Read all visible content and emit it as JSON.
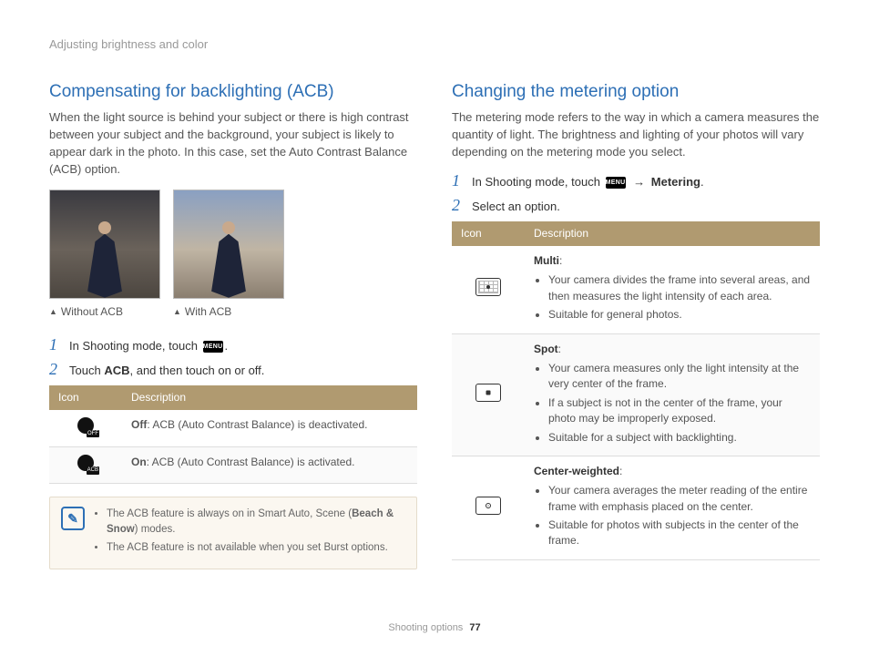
{
  "breadcrumb": "Adjusting brightness and color",
  "footer_section": "Shooting options",
  "page_number": "77",
  "left": {
    "title": "Compensating for backlighting (ACB)",
    "lead": "When the light source is behind your subject or there is high contrast between your subject and the background, your subject is likely to appear dark in the photo. In this case, set the Auto Contrast Balance (ACB) option.",
    "caption1": "Without ACB",
    "caption2": "With ACB",
    "step1_pre": "In Shooting mode, touch ",
    "step1_post": ".",
    "menu_label": "MENU",
    "step2_pre": "Touch ",
    "step2_bold": "ACB",
    "step2_post": ", and then touch on or off.",
    "th_icon": "Icon",
    "th_desc": "Description",
    "row_off_b": "Off",
    "row_off_t": ": ACB (Auto Contrast Balance) is deactivated.",
    "row_on_b": "On",
    "row_on_t": ": ACB (Auto Contrast Balance) is activated.",
    "note1_pre": "The ACB feature is always on in Smart Auto, Scene (",
    "note1_bold": "Beach & Snow",
    "note1_post": ") modes.",
    "note2": "The ACB feature is not available when you set Burst options."
  },
  "right": {
    "title": "Changing the metering option",
    "lead": "The metering mode refers to the way in which a camera measures the quantity of light. The brightness and lighting of your photos will vary depending on the metering mode you select.",
    "step1_pre": "In Shooting mode, touch ",
    "menu_label": "MENU",
    "step1_mid": " → ",
    "step1_bold": "Metering",
    "step1_post": ".",
    "step2": "Select an option.",
    "th_icon": "Icon",
    "th_desc": "Description",
    "multi_title": "Multi",
    "multi_b1": "Your camera divides the frame into several areas, and then measures the light intensity of each area.",
    "multi_b2": "Suitable for general photos.",
    "spot_title": "Spot",
    "spot_b1": "Your camera measures only the light intensity at the very center of the frame.",
    "spot_b2": "If a subject is not in the center of the frame, your photo may be improperly exposed.",
    "spot_b3": "Suitable for a subject with backlighting.",
    "center_title": "Center-weighted",
    "center_b1": "Your camera averages the meter reading of the entire frame with emphasis placed on the center.",
    "center_b2": "Suitable for photos with subjects in the center of the frame."
  }
}
